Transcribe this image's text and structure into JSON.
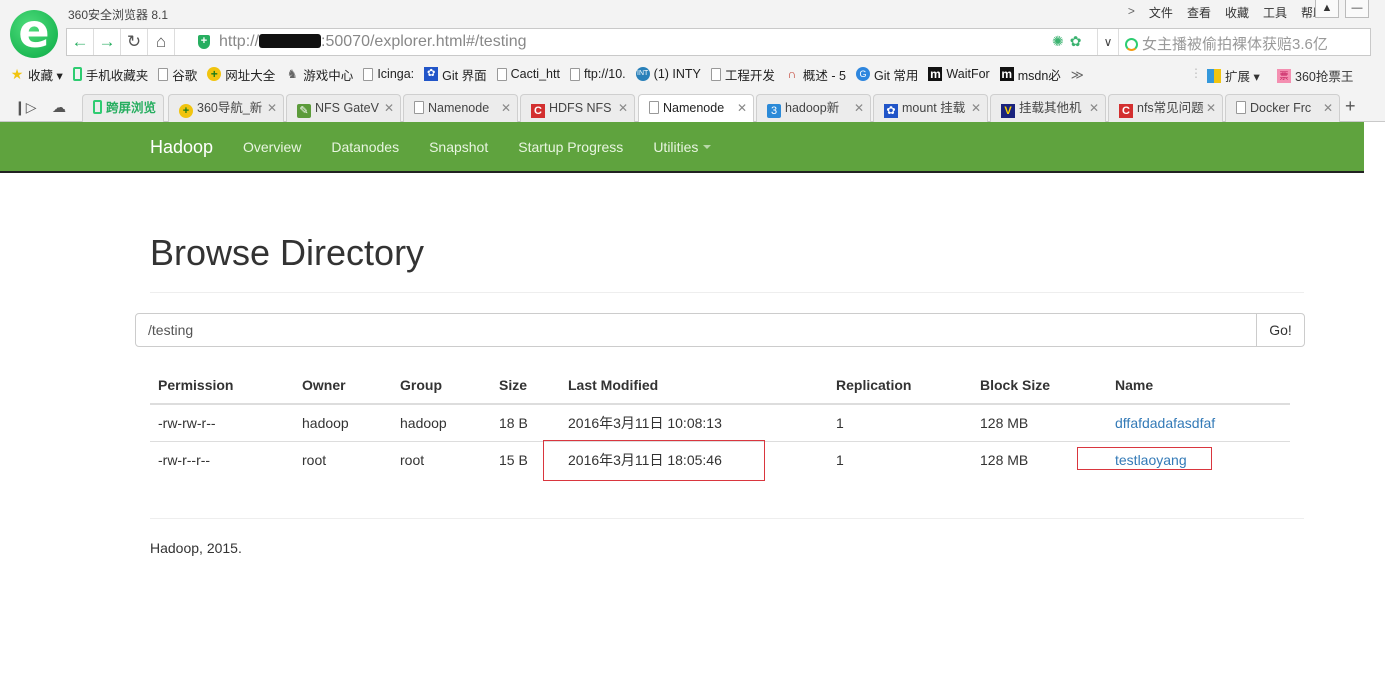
{
  "browser": {
    "app_title": "360安全浏览器 8.1",
    "menu": [
      ">",
      "文件",
      "查看",
      "收藏",
      "工具",
      "帮助"
    ],
    "address": {
      "url_prefix": "http://",
      "url_suffix": ":50070/explorer.html#/testing"
    },
    "search_placeholder": "女主播被偷拍裸体获赔3.6亿",
    "bookmarks": [
      {
        "icon": "star-icon",
        "label": "收藏 ▾"
      },
      {
        "icon": "phone-icon",
        "label": "手机收藏夹"
      },
      {
        "icon": "page-icon",
        "label": "谷歌"
      },
      {
        "icon": "nav-360-icon",
        "label": "网址大全"
      },
      {
        "icon": "gamepad-icon",
        "label": "游戏中心"
      },
      {
        "icon": "page-icon",
        "label": "Icinga:"
      },
      {
        "icon": "baidu-paw-icon",
        "label": "Git 界面"
      },
      {
        "icon": "page-icon",
        "label": "Cacti_htt"
      },
      {
        "icon": "page-icon",
        "label": "ftp://10."
      },
      {
        "icon": "inty-icon",
        "label": "(1) INTY"
      },
      {
        "icon": "page-icon",
        "label": "工程开发"
      },
      {
        "icon": "redhat-icon",
        "label": "概述 - 5"
      },
      {
        "icon": "git-circle-icon",
        "label": "Git 常用"
      },
      {
        "icon": "m-icon",
        "label": "WaitFor"
      },
      {
        "icon": "m-icon",
        "label": "msdn必"
      }
    ],
    "bookmarks_more": "≫",
    "extensions_label": "扩展 ▾",
    "ticket_label": "360抢票王",
    "tabs": [
      {
        "label": "跨屏浏览",
        "icon": "phone-icon",
        "closable": false
      },
      {
        "label": "360导航_新",
        "icon": "nav-360-icon",
        "closable": true
      },
      {
        "label": "NFS GateV",
        "icon": "evernote-icon",
        "closable": true
      },
      {
        "label": "Namenode",
        "icon": "page-icon",
        "closable": true
      },
      {
        "label": "HDFS NFS",
        "icon": "csdn-icon",
        "closable": true
      },
      {
        "label": "Namenode",
        "icon": "page-icon",
        "closable": true,
        "active": true
      },
      {
        "label": "hadoop新",
        "icon": "blue-3-icon",
        "closable": true
      },
      {
        "label": "mount 挂载",
        "icon": "baidu-paw-icon",
        "closable": true
      },
      {
        "label": "挂载其他机",
        "icon": "yellow-box-icon",
        "closable": true
      },
      {
        "label": "nfs常见问题",
        "icon": "csdn-icon",
        "closable": true
      },
      {
        "label": "Docker Frc",
        "icon": "page-icon",
        "closable": true
      }
    ]
  },
  "navbar": {
    "brand": "Hadoop",
    "items": [
      "Overview",
      "Datanodes",
      "Snapshot",
      "Startup Progress",
      "Utilities"
    ]
  },
  "main": {
    "title": "Browse Directory",
    "path_value": "/testing",
    "go_label": "Go!",
    "columns": [
      "Permission",
      "Owner",
      "Group",
      "Size",
      "Last Modified",
      "Replication",
      "Block Size",
      "Name"
    ],
    "rows": [
      [
        "-rw-rw-r--",
        "hadoop",
        "hadoop",
        "18 B",
        "2016年3月11日 10:08:13",
        "1",
        "128 MB",
        "dffafdadafasdfaf"
      ],
      [
        "-rw-r--r--",
        "root",
        "root",
        "15 B",
        "2016年3月11日 18:05:46",
        "1",
        "128 MB",
        "testlaoyang"
      ]
    ],
    "footer": "Hadoop, 2015."
  },
  "colors": {
    "navbar_green": "#5fa33e",
    "link_blue": "#337ab7",
    "annotation_red": "#d9363e"
  }
}
